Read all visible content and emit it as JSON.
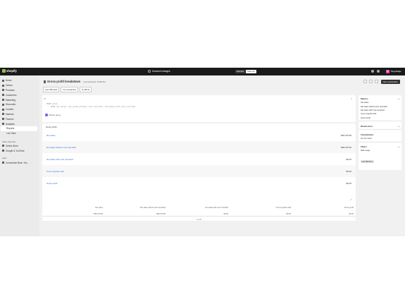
{
  "topbar": {
    "brand": "shopify",
    "unsaved": "Unsaved changes",
    "discard": "Discard",
    "save": "Save as",
    "store_initials": "TE",
    "store_name": "TargetEdge"
  },
  "sidebar": {
    "items": [
      "Home",
      "Orders",
      "Products",
      "Customers",
      "Marketing",
      "Discounts",
      "Content",
      "Markets",
      "Finance",
      "Analytics",
      "Reports",
      "Live View"
    ],
    "sales_channels": "Sales channels",
    "channel_items": [
      "Online Store",
      "Google & YouTube"
    ],
    "apps": "Apps",
    "app_items": [
      "Conversion Bear: Tra..."
    ]
  },
  "header": {
    "title": "Gross profit breakdown",
    "subtitle": "Last refreshed: 10:56 AM",
    "chips": [
      "Last 365 days",
      "No comparison",
      "$ USD $"
    ],
    "explore": "New exploration"
  },
  "query": {
    "lines": [
      "FROM sales",
      "SHOW net_sales, net_sales_without_cost_recorded, net_sales_with_cost_recorded"
    ],
    "refine": "Refine query"
  },
  "results": {
    "title": "Gross profit",
    "rows": [
      {
        "label": "Net sales",
        "value": "$38,370.96"
      },
      {
        "label": "Net sales without cost recorded",
        "value": "$38,370.96"
      },
      {
        "label": "Net sales with cost recorded",
        "value": "$0.00"
      },
      {
        "label": "Cost of goods sold",
        "value": "$0.00"
      },
      {
        "label": "Gross profit",
        "value": "$0.00"
      }
    ],
    "tot_headers": [
      "Net sales",
      "Net sales without cost recorded",
      "Net sales with cost recorded",
      "Cost of goods sold",
      "Gross profit"
    ],
    "tot_values": [
      "$38,370.96",
      "$38,370.96",
      "$0.00",
      "$0.00",
      "$0.00"
    ],
    "footer": "1 row"
  },
  "panel": {
    "metrics": "Metrics",
    "metric_items": [
      "Net sales",
      "Net sales without cost recorded",
      "Net sales with cost recorded",
      "Cost of goods sold",
      "Gross profit"
    ],
    "dimensions": "Dimensions",
    "visualization": "Visualization",
    "viz_value": "List by metric",
    "filters": "Filters",
    "filter_label": "Date range",
    "filter_value": "Last 365 days"
  }
}
